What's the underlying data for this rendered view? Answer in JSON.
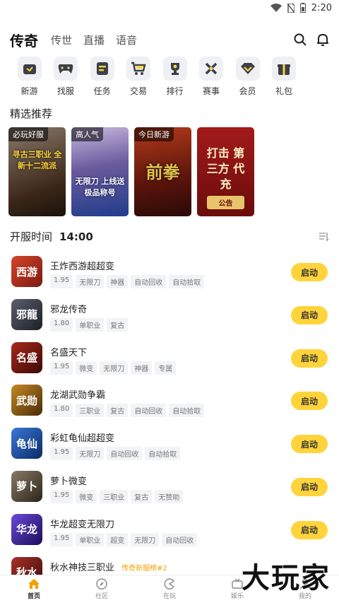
{
  "statusbar": {
    "time": "2:20"
  },
  "nav": {
    "active_tab": "传奇",
    "tabs": [
      "传世",
      "直播",
      "语音"
    ]
  },
  "categories": [
    {
      "label": "新游",
      "icon": "gamepad-new-icon"
    },
    {
      "label": "找服",
      "icon": "gamepad-icon"
    },
    {
      "label": "任务",
      "icon": "task-list-icon"
    },
    {
      "label": "交易",
      "icon": "cart-icon"
    },
    {
      "label": "排行",
      "icon": "trophy-icon"
    },
    {
      "label": "赛事",
      "icon": "crossed-swords-icon"
    },
    {
      "label": "会员",
      "icon": "diamond-icon"
    },
    {
      "label": "礼包",
      "icon": "gift-icon"
    }
  ],
  "recommend": {
    "title": "精选推荐",
    "cards": [
      {
        "badge": "必玩好服",
        "art_text": "寻古三职业 全新十二流派",
        "color": "#5a3a24"
      },
      {
        "badge": "高人气",
        "art_text": "无限刀 上线送极品称号",
        "color": "#2a4d8f"
      },
      {
        "badge": "今日新游",
        "art_text": "前拳",
        "color": "#6b1b10"
      },
      {
        "badge": "",
        "art_text": "打击 第三方 代充",
        "sub_text": "公告",
        "color": "#8b1414"
      }
    ]
  },
  "kaifu": {
    "label": "开服时间",
    "time": "14:00"
  },
  "games": [
    {
      "name": "王炸西游超超变",
      "icon_text": "西游",
      "icon_color": "#b22f1d",
      "tags": [
        "1.95",
        "无限刀",
        "神器",
        "自动回收",
        "自动拾取"
      ],
      "button": "启动"
    },
    {
      "name": "邪龙传奇",
      "icon_text": "邪龍",
      "icon_color": "#3a3f4a",
      "tags": [
        "1.80",
        "单职业",
        "复古"
      ],
      "button": "启动"
    },
    {
      "name": "名盛天下",
      "icon_text": "名盛",
      "icon_color": "#7a1a12",
      "tags": [
        "1.95",
        "微变",
        "无限刀",
        "神器",
        "专属"
      ],
      "button": "启动"
    },
    {
      "name": "龙湖武勋争霸",
      "icon_text": "武勋",
      "icon_color": "#8a5a12",
      "tags": [
        "1.80",
        "三职业",
        "复古",
        "自动回收",
        "自动拾取"
      ],
      "button": "启动"
    },
    {
      "name": "彩虹龟仙超超变",
      "icon_text": "龟仙",
      "icon_color": "#1d4f9e",
      "tags": [
        "1.95",
        "无限刀",
        "自动回收",
        "自动拾取"
      ],
      "button": "启动"
    },
    {
      "name": "萝卜微变",
      "icon_text": "萝卜",
      "icon_color": "#5a4a38",
      "tags": [
        "1.95",
        "微变",
        "三职业",
        "复古",
        "无赞助"
      ],
      "button": "启动"
    },
    {
      "name": "华龙超变无限刀",
      "icon_text": "华龙",
      "icon_color": "#3d2a8a",
      "tags": [
        "1.95",
        "单职业",
        "超变",
        "无限刀",
        "自动回收"
      ],
      "button": "启动"
    },
    {
      "name": "秋水神技三职业",
      "icon_text": "秋水",
      "icon_color": "#6b1e16",
      "extra": "传奇新服榜#2",
      "tags": [],
      "button": ""
    }
  ],
  "bottom_nav": [
    {
      "label": "首页",
      "icon": "home-icon",
      "active": true
    },
    {
      "label": "社区",
      "icon": "compass-icon",
      "active": false
    },
    {
      "label": "在玩",
      "icon": "pacman-icon",
      "active": false
    },
    {
      "label": "娱乐",
      "icon": "tv-icon",
      "active": false
    },
    {
      "label": "我的",
      "icon": "user-icon",
      "active": false
    }
  ],
  "watermark": "大玩家"
}
